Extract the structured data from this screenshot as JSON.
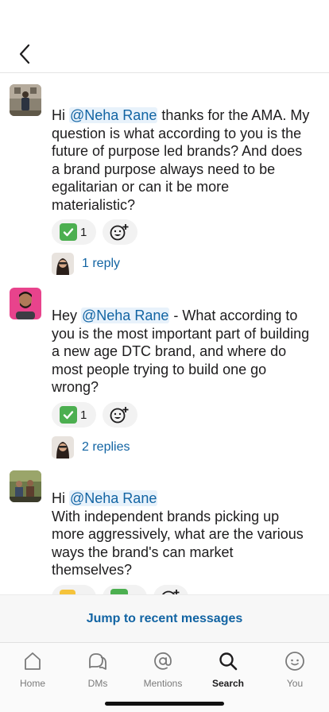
{
  "messages": [
    {
      "text_before": "Hi ",
      "mention": "@Neha Rane",
      "text_after": " thanks for the AMA. My question is what according to you is the future of purpose led brands? And does a brand purpose always need to be egalitarian or can it be more materialistic?",
      "reactions": [
        {
          "emoji": "check-mark-button",
          "count": "1"
        }
      ],
      "reply_label": "1 reply"
    },
    {
      "text_before": "Hey ",
      "mention": "@Neha Rane",
      "text_after": " - What according to you is the most important part of building a new age DTC brand, and where do most people trying to build one go wrong?",
      "reactions": [
        {
          "emoji": "check-mark-button",
          "count": "1"
        }
      ],
      "reply_label": "2 replies"
    },
    {
      "text_before": "Hi ",
      "mention": "@Neha Rane",
      "text_after": "With independent brands picking up more aggressively, what are the various ways the brand's can market themselves?"
    }
  ],
  "jump_label": "Jump to recent messages",
  "tabs": [
    {
      "label": "Home",
      "icon": "home-icon"
    },
    {
      "label": "DMs",
      "icon": "dms-icon"
    },
    {
      "label": "Mentions",
      "icon": "at-icon"
    },
    {
      "label": "Search",
      "icon": "search-icon",
      "active": true
    },
    {
      "label": "You",
      "icon": "you-icon"
    }
  ],
  "colors": {
    "link": "#1264a3",
    "mention_bg": "#e8f2fb",
    "check_green": "#4caf50"
  }
}
